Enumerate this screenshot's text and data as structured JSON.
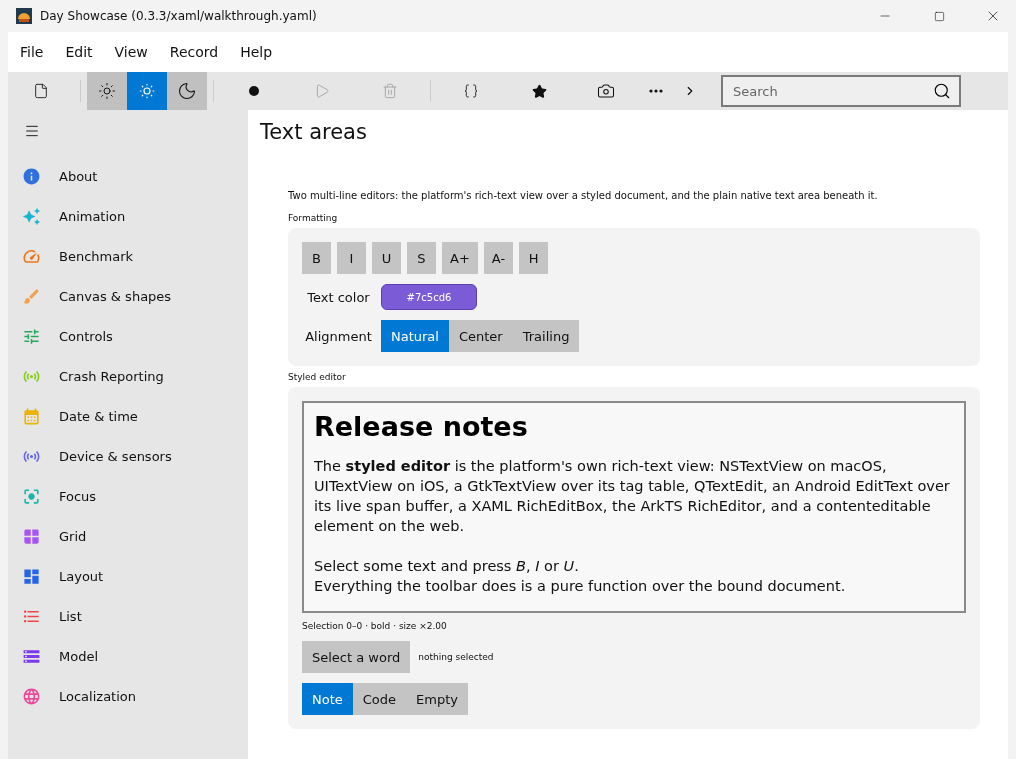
{
  "window": {
    "title": "Day Showcase (0.3.3/xaml/walkthrough.yaml)"
  },
  "menu": [
    "File",
    "Edit",
    "View",
    "Record",
    "Help"
  ],
  "toolbar": {
    "themes": [
      {
        "kind": "light",
        "selected": false
      },
      {
        "kind": "auto",
        "selected": true
      },
      {
        "kind": "dark",
        "selected": false
      }
    ],
    "actions": [
      {
        "kind": "record",
        "disabled": false
      },
      {
        "kind": "play",
        "disabled": true
      },
      {
        "kind": "delete",
        "disabled": true
      },
      {
        "kind": "braces",
        "disabled": false
      },
      {
        "kind": "star",
        "disabled": false
      },
      {
        "kind": "camera",
        "disabled": false
      },
      {
        "kind": "more",
        "disabled": false
      },
      {
        "kind": "chevron",
        "disabled": false
      }
    ],
    "search": {
      "placeholder": "Search"
    }
  },
  "sidebar": {
    "items": [
      {
        "label": "About",
        "color": "#2f6fde"
      },
      {
        "label": "Animation",
        "color": "#18b4d0"
      },
      {
        "label": "Benchmark",
        "color": "#f07414"
      },
      {
        "label": "Canvas & shapes",
        "color": "#f5a04a"
      },
      {
        "label": "Controls",
        "color": "#28a65a"
      },
      {
        "label": "Crash Reporting",
        "color": "#84cc16"
      },
      {
        "label": "Date & time",
        "color": "#eab308"
      },
      {
        "label": "Device & sensors",
        "color": "#6366f1"
      },
      {
        "label": "Focus",
        "color": "#14b8a6"
      },
      {
        "label": "Grid",
        "color": "#a855f7"
      },
      {
        "label": "Layout",
        "color": "#2563eb"
      },
      {
        "label": "List",
        "color": "#ef4444"
      },
      {
        "label": "Model",
        "color": "#7c3aed"
      },
      {
        "label": "Localization",
        "color": "#ec4899"
      }
    ]
  },
  "page": {
    "title": "Text areas",
    "description": "Two multi-line editors: the platform's rich-text view over a styled document, and the plain native text area beneath it.",
    "formatting": {
      "label": "Formatting",
      "buttons": [
        "B",
        "I",
        "U",
        "S",
        "A+",
        "A-",
        "H"
      ],
      "text_color": {
        "label": "Text color",
        "value": "#7c5cd6"
      },
      "alignment": {
        "label": "Alignment",
        "options": [
          {
            "label": "Natural",
            "selected": true
          },
          {
            "label": "Center",
            "selected": false
          },
          {
            "label": "Trailing",
            "selected": false
          }
        ]
      }
    },
    "styled_editor": {
      "label": "Styled editor",
      "heading": "Release notes",
      "paragraphs": [
        [
          "The **styled editor** is the platform's own rich-text view: NSTextView on macOS, UITextView on iOS, a GtkTextView over its tag table, QTextEdit, an Android EditText over its live span buffer, a XAML RichEditBox, the ArkTS RichEditor, and a contenteditable element on the web."
        ],
        [
          "Select some text and press *B*, *I* or *U*.",
          "Everything the toolbar does is a pure function over the bound document."
        ]
      ],
      "status": "Selection 0–0 · bold · size ×2.00",
      "select_button": "Select a word",
      "selection_note": "nothing selected",
      "documents": [
        {
          "label": "Note",
          "selected": true
        },
        {
          "label": "Code",
          "selected": false
        },
        {
          "label": "Empty",
          "selected": false
        }
      ]
    }
  }
}
